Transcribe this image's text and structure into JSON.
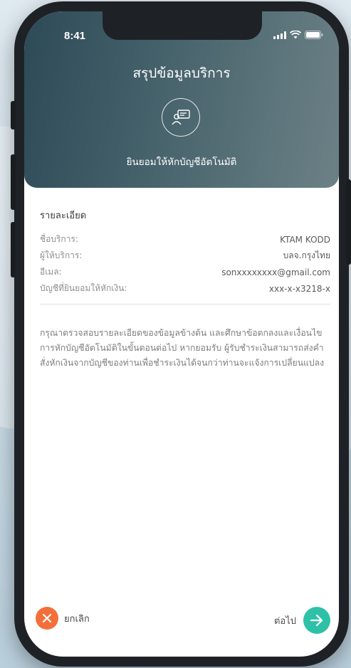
{
  "status_bar": {
    "time": "8:41"
  },
  "header": {
    "title": "สรุปข้อมูลบริการ",
    "subtitle": "ยินยอมให้หักบัญชีอัตโนมัติ",
    "icon": "person-card-icon"
  },
  "details": {
    "section_title": "รายละเอียด",
    "rows": [
      {
        "label": "ชื่อบริการ:",
        "value": "KTAM KODD"
      },
      {
        "label": "ผู้ให้บริการ:",
        "value": "บลจ.กรุงไทย"
      },
      {
        "label": "อีเมล:",
        "value": "sonxxxxxxxx@gmail.com"
      },
      {
        "label": "บัญชีที่ยินยอมให้หักเงิน:",
        "value": "xxx-x-x3218-x"
      }
    ]
  },
  "notice": "กรุณาตรวจสอบรายละเอียดของข้อมูลข้างต้น และศึกษาข้อตกลงและเงื่อนไขการหักบัญชีอัตโนมัติในขั้นตอนต่อไป หากยอมรับ ผู้รับชำระเงินสามารถส่งคำสั่งหักเงินจากบัญชีของท่านเพื่อชำระเงินได้จนกว่าท่านจะแจ้งการเปลี่ยนแปลง",
  "footer": {
    "cancel_label": "ยกเลิก",
    "next_label": "ต่อไป"
  },
  "colors": {
    "header_start": "#2d4a57",
    "header_end": "#6c8186",
    "cancel": "#f36f3a",
    "next": "#2fc1a8"
  }
}
